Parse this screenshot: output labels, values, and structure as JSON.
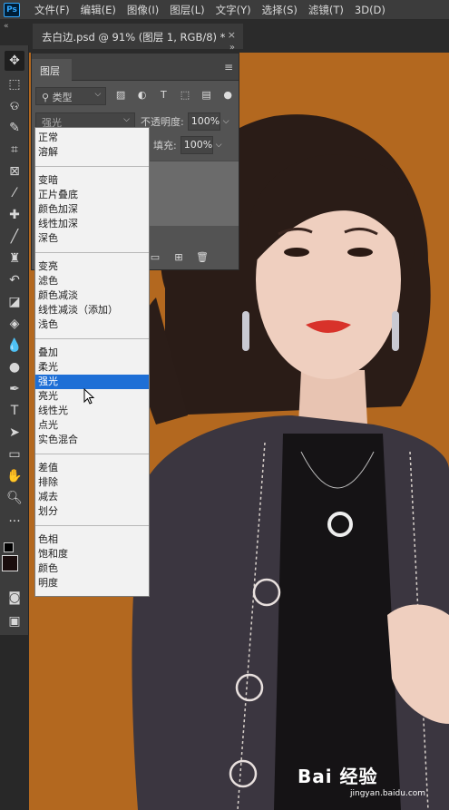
{
  "app": {
    "logo_text": "Ps"
  },
  "menu": [
    {
      "label": "文件(F)"
    },
    {
      "label": "编辑(E)"
    },
    {
      "label": "图像(I)"
    },
    {
      "label": "图层(L)"
    },
    {
      "label": "文字(Y)"
    },
    {
      "label": "选择(S)"
    },
    {
      "label": "滤镜(T)"
    },
    {
      "label": "3D(D)"
    }
  ],
  "document_tab": {
    "title": "去白边.psd @ 91% (图层 1, RGB/8) *",
    "close": "×"
  },
  "layers_panel": {
    "tab_label": "图层",
    "filter_label": "类型",
    "blend_mode_current": "强光",
    "opacity_label": "不透明度:",
    "opacity_value": "100%",
    "fill_label": "填充:",
    "fill_value": "100%"
  },
  "blend_dropdown": {
    "groups": [
      [
        "正常",
        "溶解"
      ],
      [
        "变暗",
        "正片叠底",
        "颜色加深",
        "线性加深",
        "深色"
      ],
      [
        "变亮",
        "滤色",
        "颜色减淡",
        "线性减淡（添加）",
        "浅色"
      ],
      [
        "叠加",
        "柔光",
        "强光",
        "亮光",
        "线性光",
        "点光",
        "实色混合"
      ],
      [
        "差值",
        "排除",
        "减去",
        "划分"
      ],
      [
        "色相",
        "饱和度",
        "颜色",
        "明度"
      ]
    ],
    "selected": "强光"
  },
  "watermark": {
    "logo": "Bai 经验",
    "url": "jingyan.baidu.com"
  },
  "colors": {
    "canvas_bg": "#b3681f",
    "selection": "#1e6fd6",
    "panel": "#535353"
  }
}
